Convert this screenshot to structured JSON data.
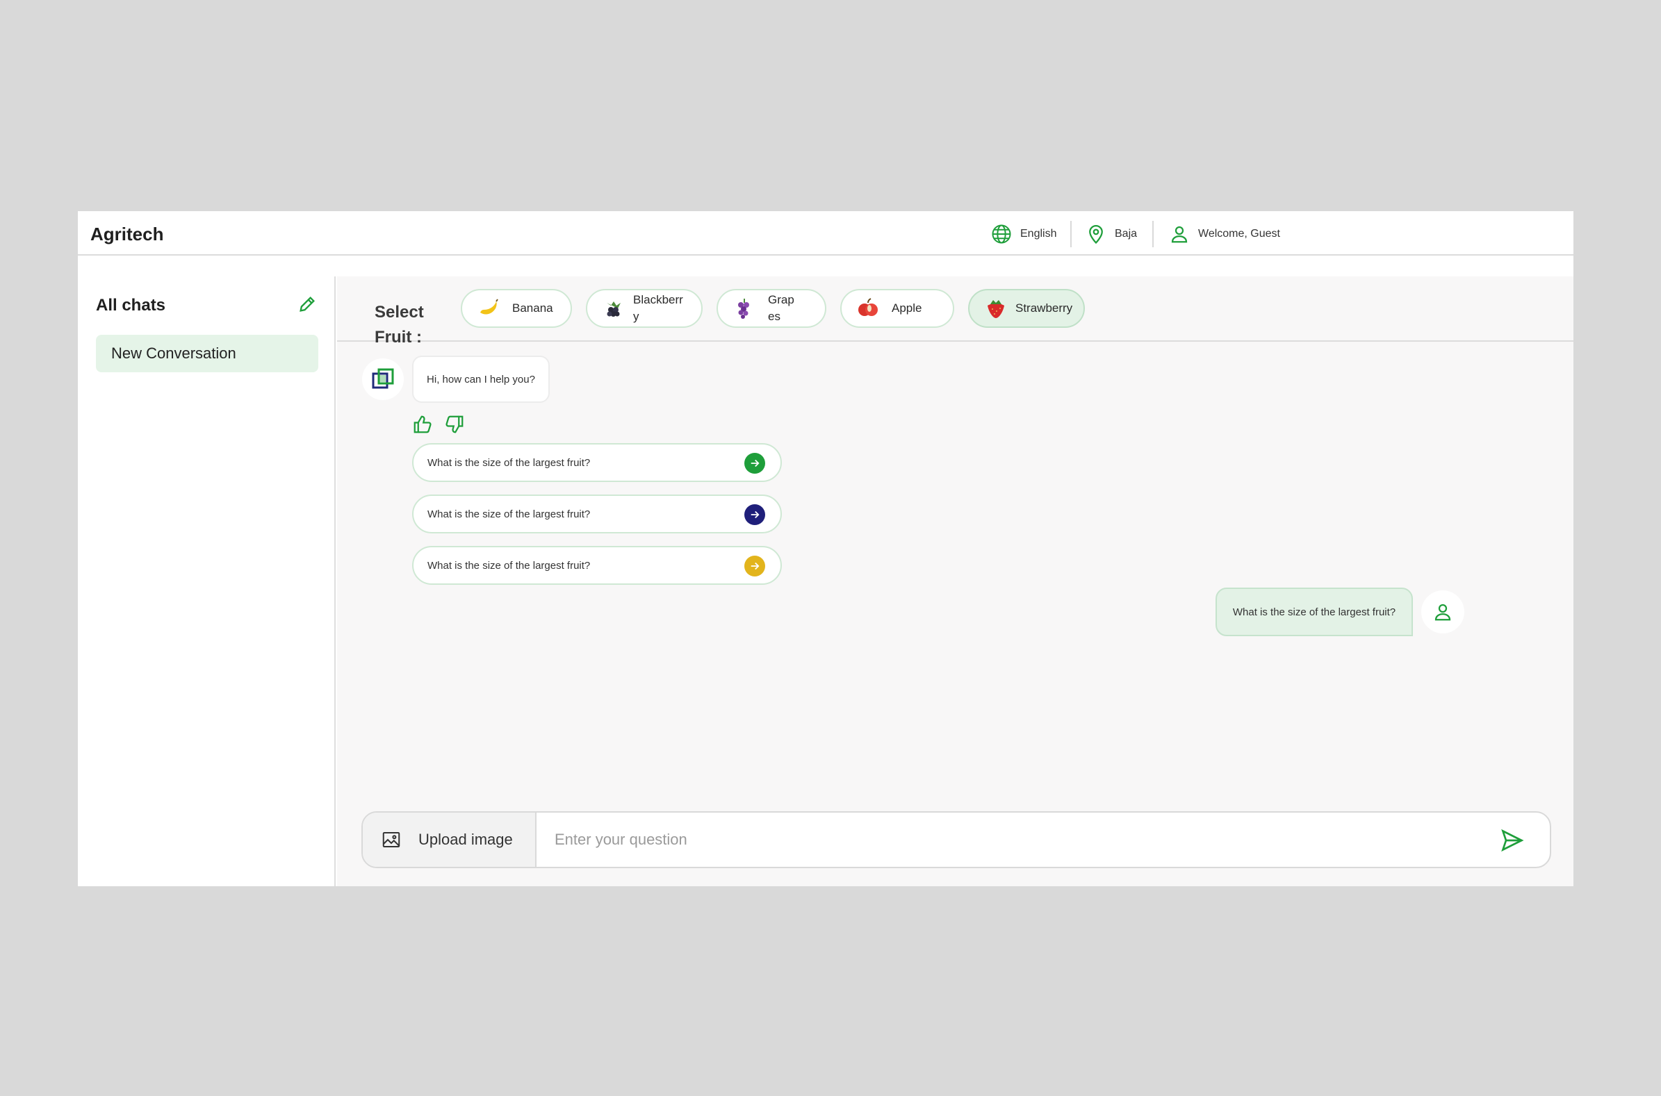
{
  "header": {
    "brand": "Agritech",
    "language": "English",
    "location": "Baja",
    "welcome": "Welcome, Guest"
  },
  "sidebar": {
    "title": "All chats",
    "conversations": [
      {
        "label": "New Conversation"
      }
    ]
  },
  "fruit_bar": {
    "label": "Select Fruit :",
    "fruits": [
      {
        "label": "Banana",
        "icon": "banana-icon",
        "active": false
      },
      {
        "label": "Blackberry",
        "icon": "blackberry-icon",
        "active": false
      },
      {
        "label": "Grapes",
        "icon": "grapes-icon",
        "active": false
      },
      {
        "label": "Apple",
        "icon": "apple-icon",
        "active": false
      },
      {
        "label": "Strawberry",
        "icon": "strawberry-icon",
        "active": true
      }
    ]
  },
  "chat": {
    "bot_message": "Hi, how can I help you?",
    "suggestions": [
      {
        "text": "What is the size of the largest fruit?",
        "color": "#1e9e3a"
      },
      {
        "text": "What is the size of the largest fruit?",
        "color": "#1f1f7a"
      },
      {
        "text": "What is the size of the largest fruit?",
        "color": "#e2b41c"
      }
    ],
    "user_message": "What is the size of the largest fruit?"
  },
  "composer": {
    "upload_label": "Upload image",
    "placeholder": "Enter your question"
  },
  "colors": {
    "accent": "#1e9e3a",
    "chip_border": "#cfe8d4",
    "active_bg": "#e3f2e6"
  }
}
